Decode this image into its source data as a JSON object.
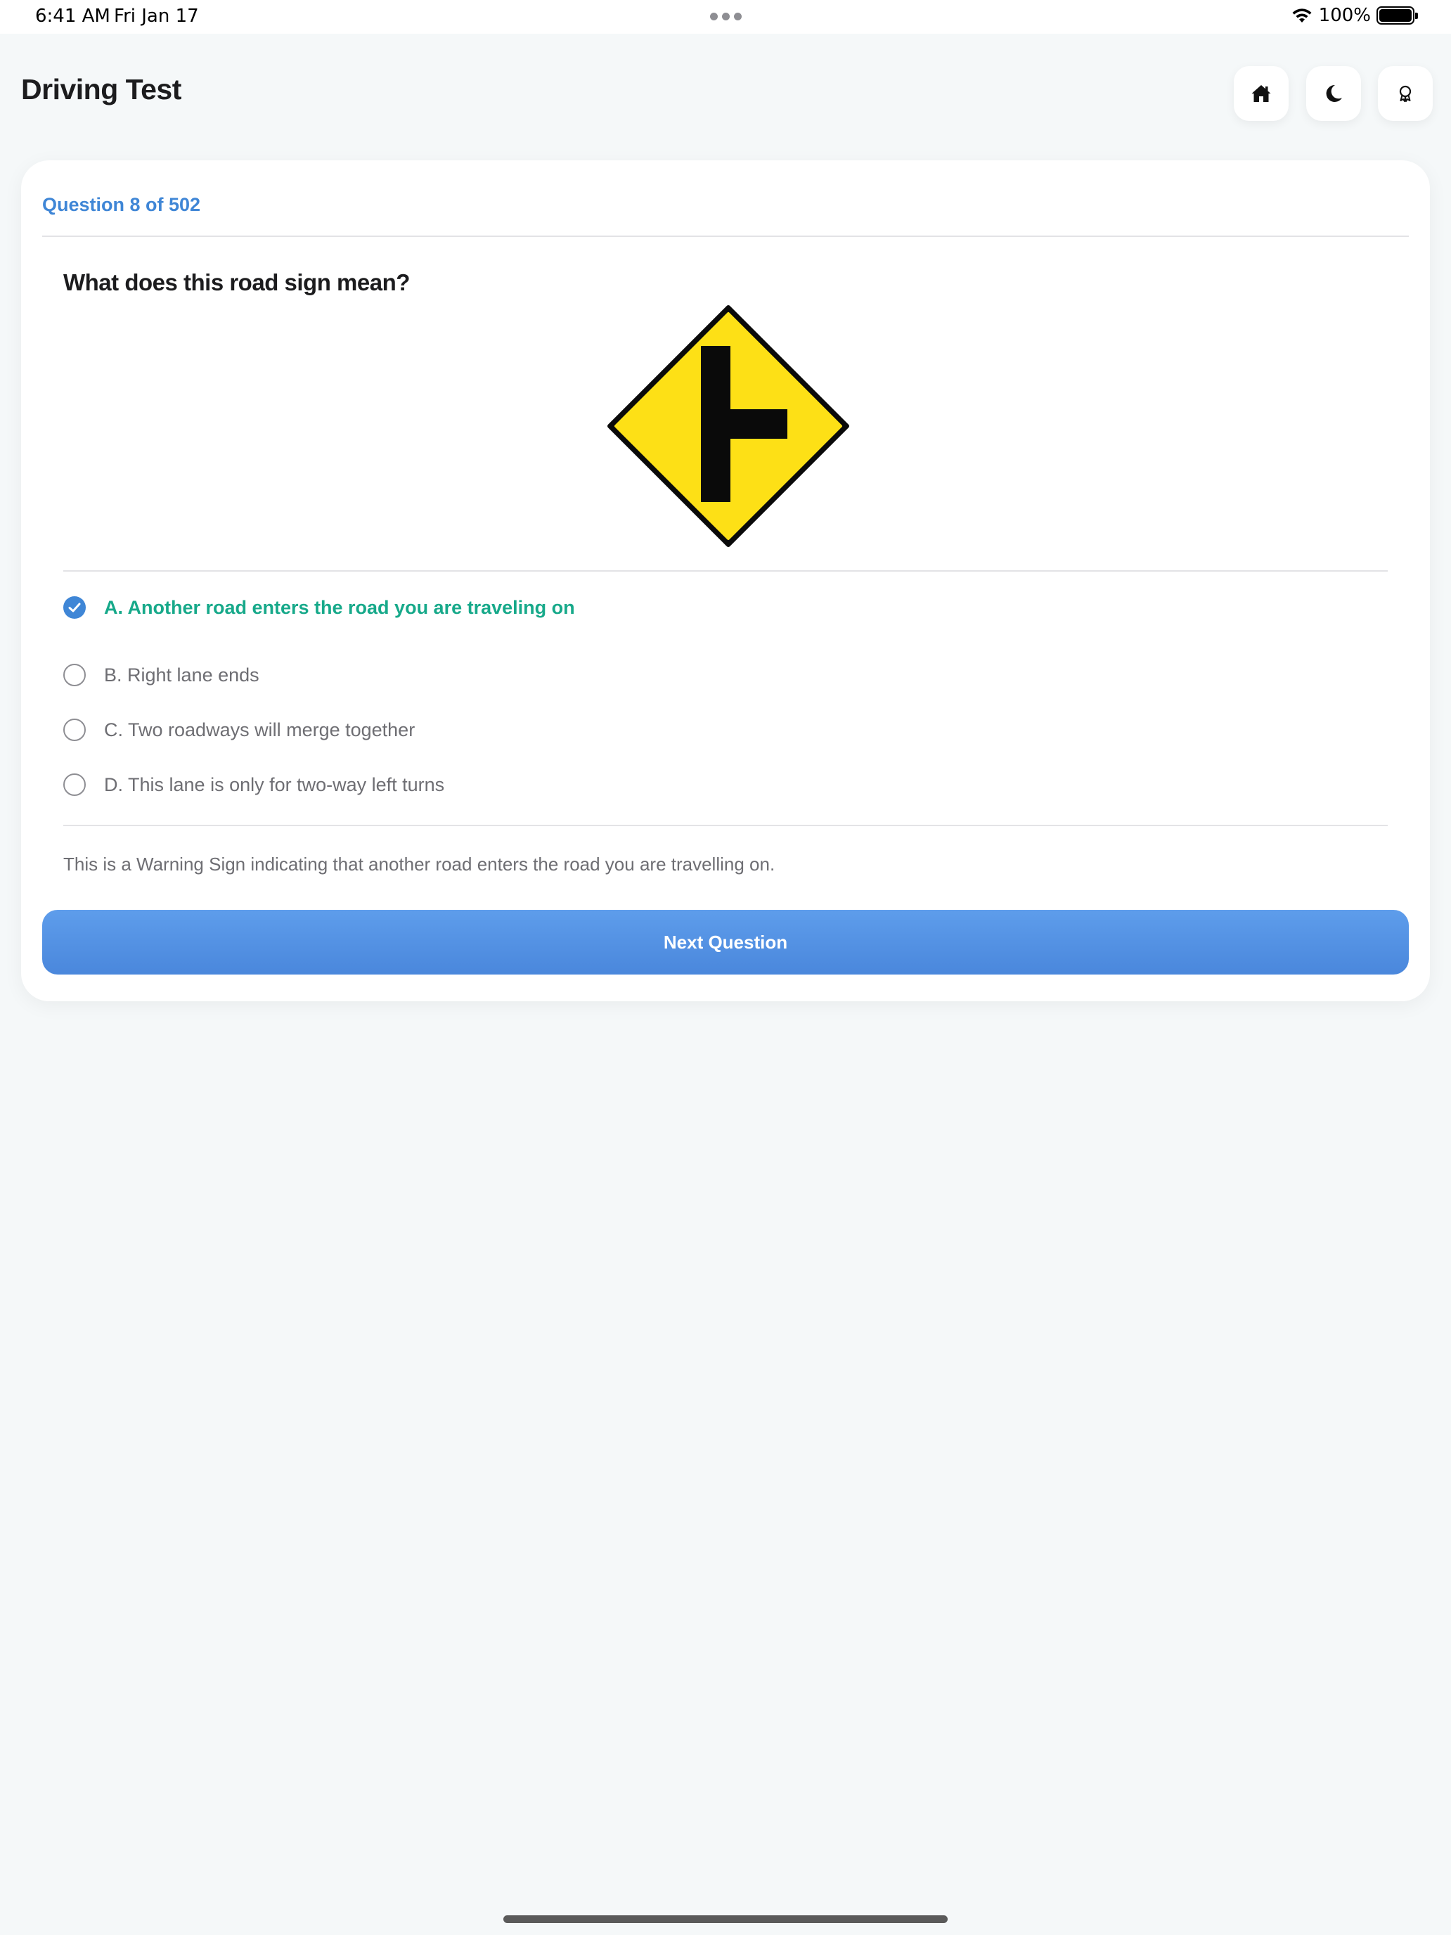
{
  "status_bar": {
    "time": "6:41 AM",
    "date": "Fri Jan 17",
    "battery": "100%",
    "battery_level": 1.0
  },
  "header": {
    "title": "Driving Test",
    "buttons": {
      "home_icon": "home-icon",
      "theme_icon": "moon-icon",
      "awards_icon": "award-ribbon-icon"
    }
  },
  "question": {
    "counter": "Question 8 of 502",
    "text": "What does this road sign mean?",
    "image": "side-road-junction-warning-sign",
    "sign_colors": {
      "fill": "#FDE016",
      "symbol": "#0a0a0a"
    },
    "options": [
      {
        "label": "A. Another road enters the road you are traveling on",
        "selected": true,
        "correct": true
      },
      {
        "label": "B. Right lane ends",
        "selected": false,
        "correct": false
      },
      {
        "label": "C. Two roadways will merge together",
        "selected": false,
        "correct": false
      },
      {
        "label": "D. This lane is only for two-way left turns",
        "selected": false,
        "correct": false
      }
    ],
    "explanation": "This is a Warning Sign indicating that another road enters the road you are travelling on."
  },
  "actions": {
    "next_label": "Next Question"
  },
  "colors": {
    "accent": "#3F86D6",
    "correct": "#17A98A",
    "background": "#F5F8F9"
  }
}
